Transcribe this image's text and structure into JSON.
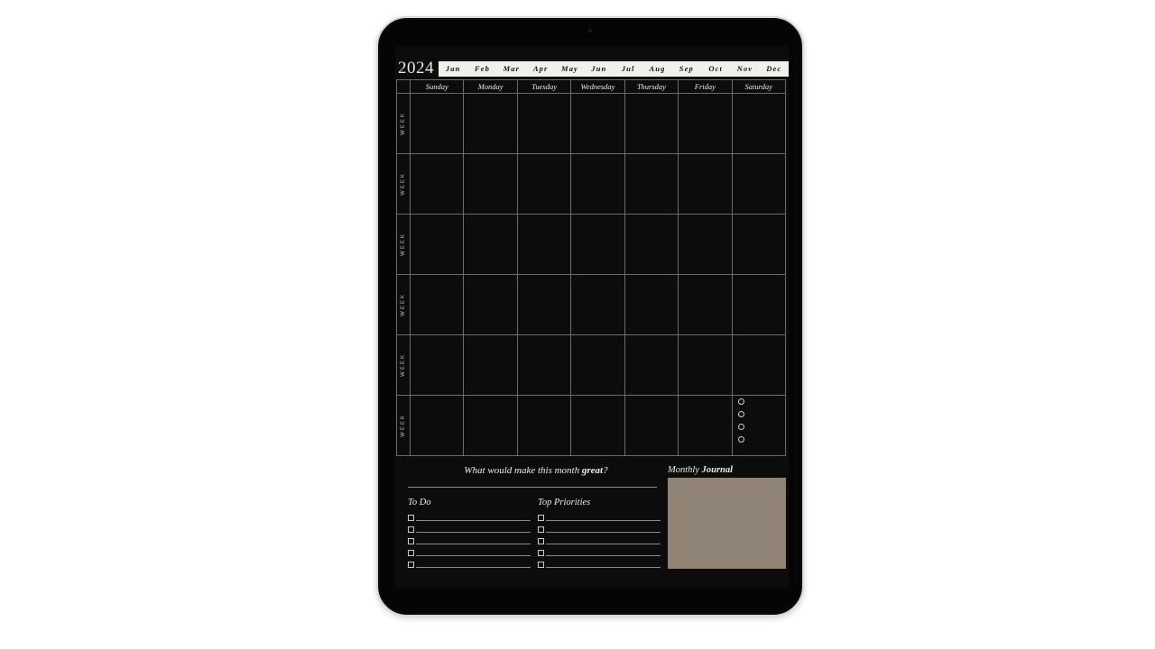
{
  "device": {
    "name": "tablet",
    "camera_icon": "camera-dot"
  },
  "planner": {
    "year": "2024",
    "months": [
      {
        "label": "Jan",
        "active": false
      },
      {
        "label": "Feb",
        "active": false
      },
      {
        "label": "Mar",
        "active": false
      },
      {
        "label": "Apr",
        "active": false
      },
      {
        "label": "May",
        "active": false
      },
      {
        "label": "Jun",
        "active": false
      },
      {
        "label": "Jul",
        "active": false
      },
      {
        "label": "Aug",
        "active": false
      },
      {
        "label": "Sep",
        "active": false
      },
      {
        "label": "Oct",
        "active": false
      },
      {
        "label": "Nov",
        "active": false
      },
      {
        "label": "Dec",
        "active": false
      }
    ],
    "day_names": [
      "Sunday",
      "Monday",
      "Tuesday",
      "Wednesday",
      "Thursday",
      "Friday",
      "Saturday"
    ],
    "week_label": "WEEK",
    "week_count": 6,
    "cell_marks": {
      "row": 6,
      "column": "Saturday",
      "bullet_count": 4,
      "icon": "circle-outline-icon"
    }
  },
  "lower_panel": {
    "prompt_prefix": "What would make this month ",
    "prompt_emphasis": "great",
    "prompt_suffix": "?",
    "todo": {
      "title": "To Do",
      "rows": 5,
      "items": [
        "",
        "",
        "",
        "",
        ""
      ]
    },
    "priorities": {
      "title": "Top Priorities",
      "rows": 5,
      "items": [
        "",
        "",
        "",
        "",
        ""
      ]
    },
    "journal": {
      "title_prefix": "Monthly ",
      "title_emphasis": "Journal",
      "thumbnail_color": "#8e8375"
    }
  },
  "colors": {
    "page_background": "#0c0c0c",
    "grid_line": "#6b6b6b",
    "text_light": "#f0ece6",
    "tab_bar_background": "#f2f0ea",
    "tab_text": "#15120e",
    "journal_thumb": "#8e8375",
    "page_surround": "#ffffff"
  }
}
